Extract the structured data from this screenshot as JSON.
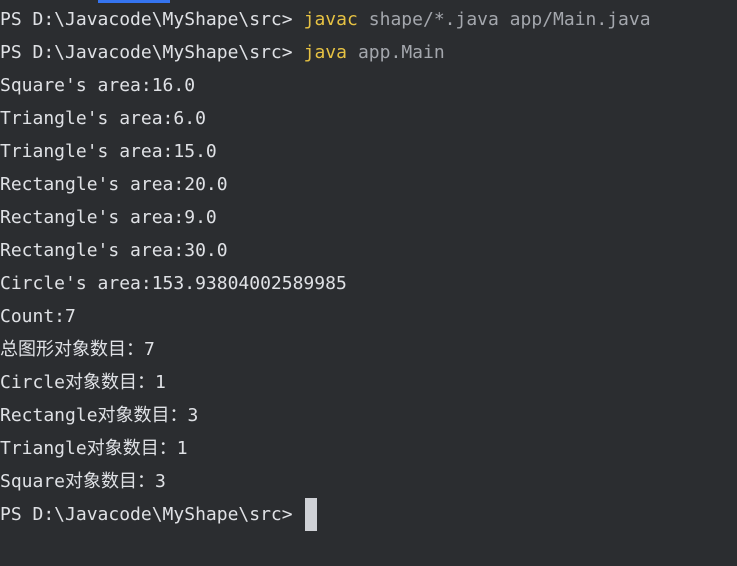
{
  "terminal": {
    "prompt": "PS D:\\Javacode\\MyShape\\src>",
    "commands": [
      {
        "cmd": "javac",
        "args": "shape/*.java app/Main.java"
      },
      {
        "cmd": "java",
        "args": "app.Main"
      }
    ],
    "output": [
      "Square's area:16.0",
      "Triangle's area:6.0",
      "Triangle's area:15.0",
      "Rectangle's area:20.0",
      "Rectangle's area:9.0",
      "Rectangle's area:30.0",
      "Circle's area:153.93804002589985",
      "Count:7",
      "总图形对象数目：7",
      "Circle对象数目：1",
      "Rectangle对象数目：3",
      "Triangle对象数目：1",
      "Square对象数目：3"
    ]
  },
  "colors": {
    "background": "#2b2d30",
    "text": "#dfe1e5",
    "command": "#e6c243",
    "args": "#a4a7ad",
    "accent": "#3574f0"
  }
}
